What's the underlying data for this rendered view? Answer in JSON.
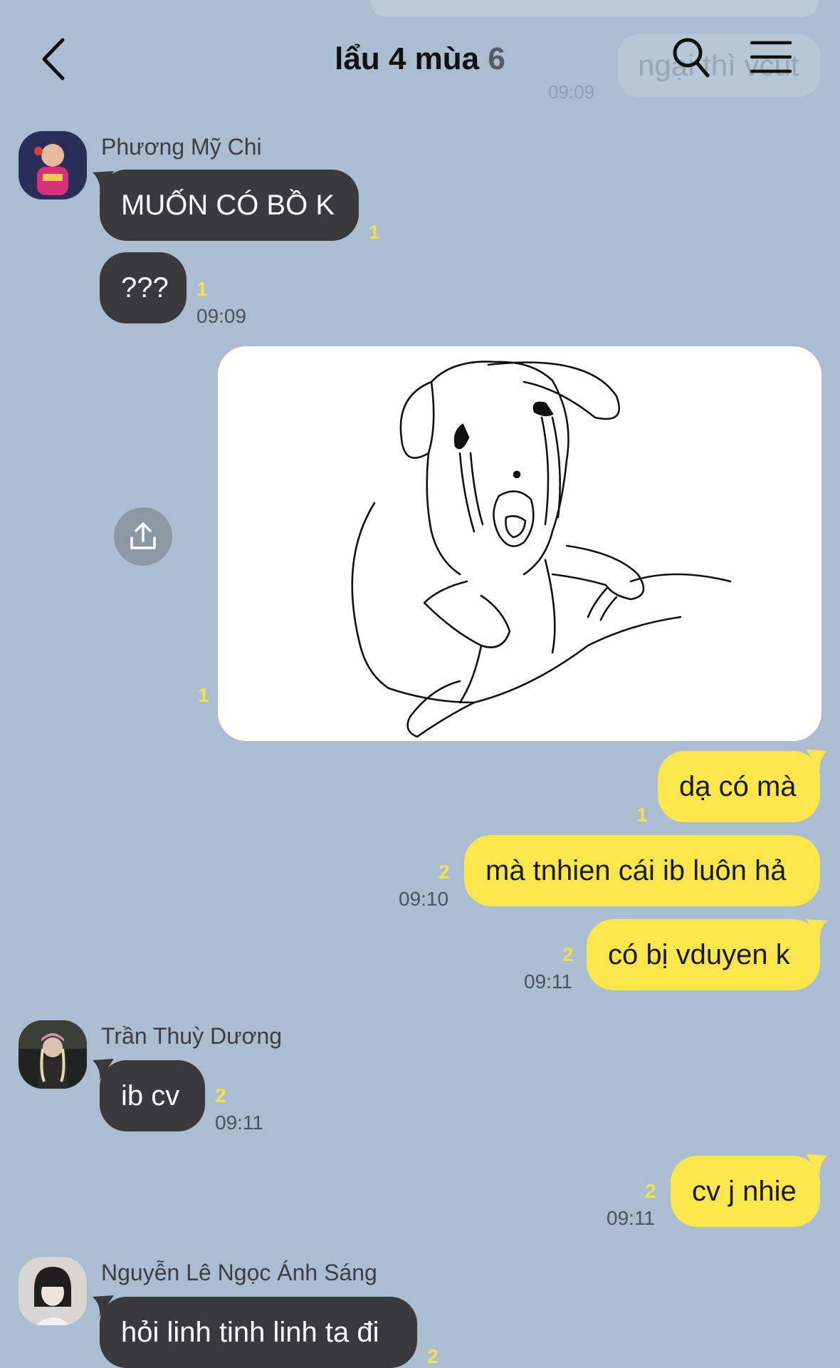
{
  "header": {
    "title": "lẩu 4 mùa",
    "member_count": "6",
    "ghost_bubble_text": "ngại thì vcut",
    "ghost_time": "09:09"
  },
  "messages": [
    {
      "sender": "Phương Mỹ Chi",
      "text": "MUỐN CÓ BỒ K",
      "unread": "1"
    },
    {
      "text": "???",
      "unread": "1",
      "time": "09:09"
    },
    {
      "type": "image",
      "unread": "1"
    },
    {
      "text": "dạ có mà",
      "unread": "1"
    },
    {
      "text": "mà tnhien cái ib luôn hả",
      "unread": "2",
      "time": "09:10"
    },
    {
      "text": "có bị vduyen k",
      "unread": "2",
      "time": "09:11"
    },
    {
      "sender": "Trần Thuỳ Dương",
      "text": "ib cv",
      "unread": "2",
      "time": "09:11"
    },
    {
      "text": "cv j nhie",
      "unread": "2",
      "time": "09:11"
    },
    {
      "sender": "Nguyễn Lê Ngọc Ánh Sáng",
      "text": "hỏi linh tinh linh ta đi",
      "unread": "2"
    }
  ],
  "colors": {
    "background": "#abbdd0",
    "incoming_bubble": "#3a3a3c",
    "outgoing_bubble": "#fbe74b",
    "unread_count": "#f7e14a"
  },
  "icons": {
    "back": "chevron-left-icon",
    "search": "search-icon",
    "menu": "hamburger-menu-icon",
    "share": "share-upload-icon"
  }
}
